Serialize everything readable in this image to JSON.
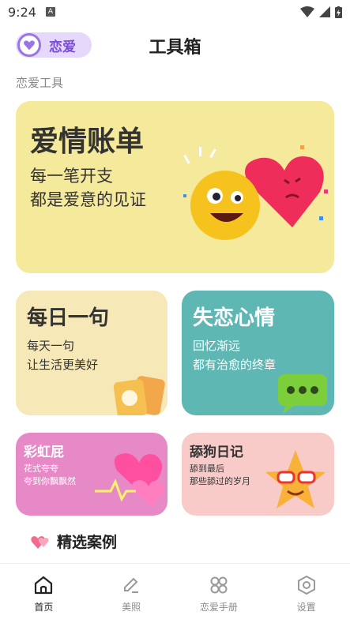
{
  "status": {
    "time": "9:24",
    "badge": "A"
  },
  "header": {
    "brand_label": "恋爱",
    "title": "工具箱"
  },
  "section_label": "恋爱工具",
  "cards": {
    "hero": {
      "title": "爱情账单",
      "line1": "每一笔开支",
      "line2": "都是爱意的见证"
    },
    "daily": {
      "title": "每日一句",
      "line1": "每天一句",
      "line2": "让生活更美好"
    },
    "heartbreak": {
      "title": "失恋心情",
      "line1": "回忆渐远",
      "line2": "都有治愈的终章"
    },
    "rainbow": {
      "title": "彩虹屁",
      "line1": "花式夸夸",
      "line2": "夸到你飘飘然"
    },
    "dog": {
      "title": "舔狗日记",
      "line1": "舔到最后",
      "line2": "那些舔过的岁月"
    }
  },
  "cases_title": "精选案例",
  "tabs": [
    {
      "label": "首页",
      "icon": "home-icon"
    },
    {
      "label": "美照",
      "icon": "edit-icon"
    },
    {
      "label": "恋爱手册",
      "icon": "grid-icon"
    },
    {
      "label": "设置",
      "icon": "settings-icon"
    }
  ]
}
